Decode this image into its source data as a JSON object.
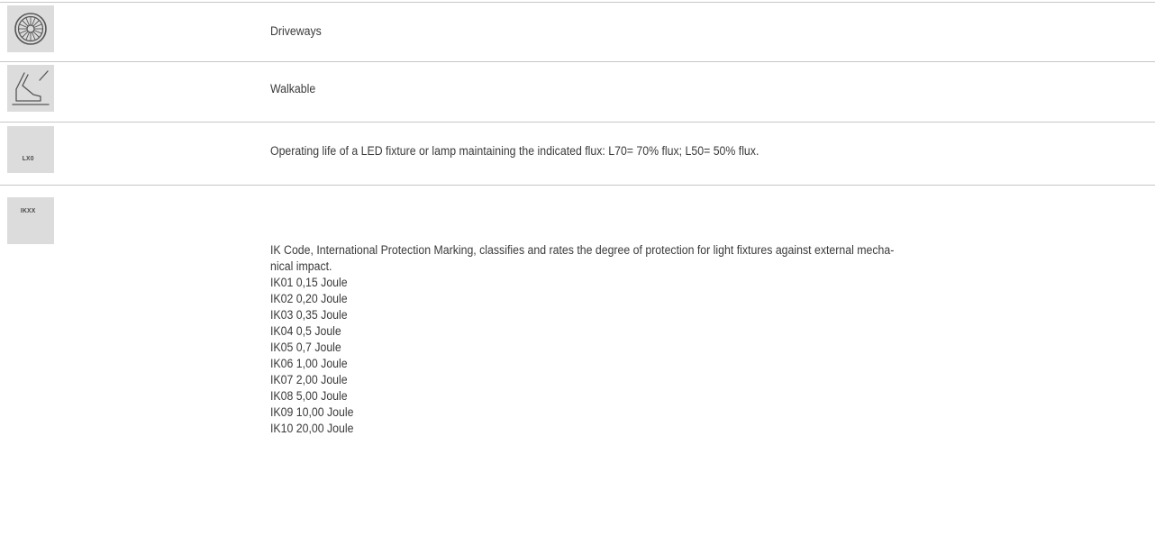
{
  "legend": {
    "rows": [
      {
        "icon": "driveway-wheel-icon",
        "text": "Driveways"
      },
      {
        "icon": "walkable-foot-icon",
        "text": "Walkable"
      },
      {
        "icon": "lx0-code-icon",
        "code": "LX0",
        "text": "Operating life of a LED fixture or lamp maintaining the indicated flux: L70= 70% flux; L50= 50% flux."
      },
      {
        "icon": "ikxx-code-icon",
        "code": "IKXX",
        "text": "IK Code, International Protection Marking, classifies and rates the degree of protection for light fixtures against external mecha-nical impact.",
        "text_line1": "IK Code, International Protection Marking, classifies and rates the degree of protection for light fixtures against external mecha-",
        "text_line2": "nical impact.",
        "ratings": [
          "IK01 0,15 Joule",
          "IK02 0,20 Joule",
          "IK03 0,35 Joule",
          "IK04 0,5 Joule",
          "IK05 0,7 Joule",
          "IK06 1,00 Joule",
          "IK07 2,00 Joule",
          "IK08 5,00 Joule",
          "IK09 10,00 Joule",
          "IK10 20,00 Joule"
        ]
      }
    ]
  },
  "colors": {
    "icon_bg": "#dcdcdc",
    "rule": "#c6c6c6",
    "text": "#3a3a3a"
  }
}
